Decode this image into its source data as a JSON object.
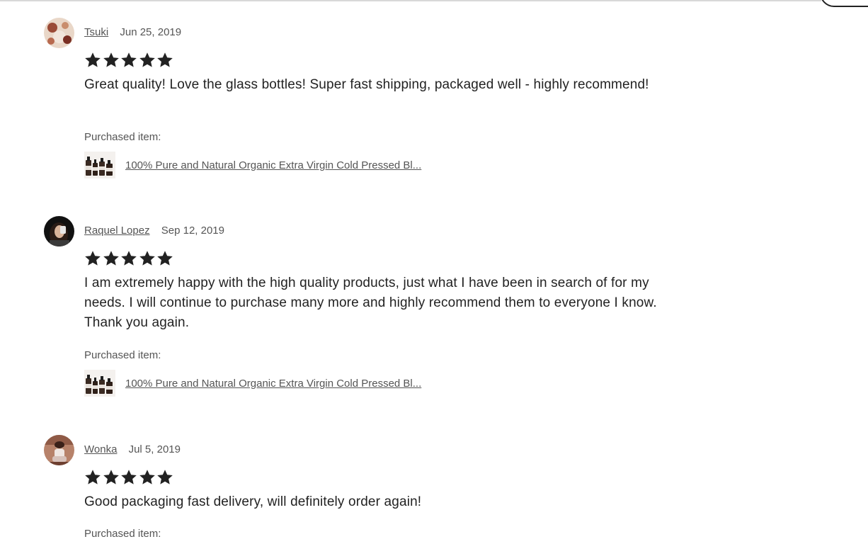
{
  "reviews": [
    {
      "reviewer": "Tsuki",
      "date": "Jun 25, 2019",
      "rating": 5,
      "text": "Great quality! Love the glass bottles! Super fast shipping, packaged well - highly recommend!",
      "purchased_label": "Purchased item:",
      "item_title": "100% Pure and Natural Organic Extra Virgin Cold Pressed Bl..."
    },
    {
      "reviewer": "Raquel Lopez",
      "date": "Sep 12, 2019",
      "rating": 5,
      "text": "I am extremely happy with the high quality products, just what I have been in search of for my needs. I will continue to purchase many more and highly recommend them to everyone I know. Thank you again.",
      "purchased_label": "Purchased item:",
      "item_title": "100% Pure and Natural Organic Extra Virgin Cold Pressed Bl..."
    },
    {
      "reviewer": "Wonka",
      "date": "Jul 5, 2019",
      "rating": 5,
      "text": "Good packaging fast delivery, will definitely order again!",
      "purchased_label": "Purchased item:"
    }
  ],
  "icons": {
    "star": "star-icon",
    "avatar": "avatar",
    "thumbnail": "product-thumbnail"
  },
  "colors": {
    "star": "#222222",
    "text": "#222222",
    "muted": "#555555"
  }
}
